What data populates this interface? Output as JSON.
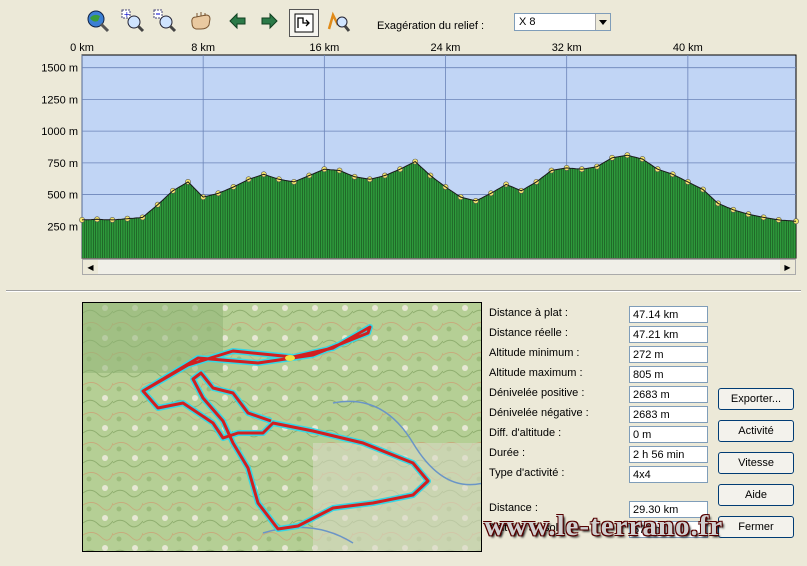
{
  "toolbar": {
    "icons": [
      "zoom-extent-icon",
      "zoom-in-icon",
      "zoom-out-icon",
      "hand-pan-icon",
      "arrow-left-icon",
      "arrow-right-icon",
      "profile-select-icon",
      "zoom-profile-icon"
    ],
    "relief_label": "Exagération du relief :",
    "relief_value": "X 8"
  },
  "chart_data": {
    "type": "area",
    "x_unit": "km",
    "y_unit": "m",
    "x_tick_labels": [
      "0 km",
      "8 km",
      "16 km",
      "24 km",
      "32 km",
      "40 km"
    ],
    "x_ticks": [
      0,
      8,
      16,
      24,
      32,
      40
    ],
    "y_tick_labels": [
      "1500 m",
      "1250 m",
      "1000 m",
      "750 m",
      "500 m",
      "250 m"
    ],
    "y_ticks": [
      1500,
      1250,
      1000,
      750,
      500,
      250
    ],
    "xlim": [
      0,
      47.14
    ],
    "ylim": [
      0,
      1600
    ],
    "grid": true,
    "colors": {
      "sky": "#c1d5f5",
      "fill": "#2e9a3c",
      "dark": "#0a1c0a",
      "point": "#f6e66b",
      "grid": "#6b84b8"
    },
    "x": [
      0,
      1,
      2,
      3,
      4,
      5,
      6,
      7,
      8,
      9,
      10,
      11,
      12,
      13,
      14,
      15,
      16,
      17,
      18,
      19,
      20,
      21,
      22,
      23,
      24,
      25,
      26,
      27,
      28,
      29,
      30,
      31,
      32,
      33,
      34,
      35,
      36,
      37,
      38,
      39,
      40,
      41,
      42,
      43,
      44,
      45,
      46,
      47.14
    ],
    "values": [
      300,
      305,
      300,
      310,
      320,
      420,
      530,
      600,
      480,
      510,
      560,
      620,
      660,
      620,
      600,
      650,
      700,
      690,
      640,
      620,
      650,
      700,
      760,
      650,
      560,
      480,
      450,
      510,
      580,
      530,
      600,
      690,
      710,
      700,
      720,
      790,
      810,
      780,
      700,
      660,
      600,
      540,
      430,
      380,
      345,
      320,
      300,
      290
    ]
  },
  "stats": [
    {
      "label": "Distance à plat :",
      "value": "47.14 km"
    },
    {
      "label": "Distance réelle :",
      "value": "47.21 km"
    },
    {
      "label": "Altitude minimum :",
      "value": "272 m"
    },
    {
      "label": "Altitude maximum :",
      "value": "805 m"
    },
    {
      "label": "Dénivelée positive :",
      "value": "2683 m"
    },
    {
      "label": "Dénivelée négative :",
      "value": "2683 m"
    },
    {
      "label": "Diff. d'altitude :",
      "value": "0 m"
    },
    {
      "label": "Durée :",
      "value": "2 h 56 min"
    },
    {
      "label": "Type d'activité :",
      "value": "4x4"
    }
  ],
  "cursor": [
    {
      "label": "Distance :",
      "value": "29.30 km"
    },
    {
      "label": "Altitude au sol :",
      "value": "576 m"
    }
  ],
  "buttons": {
    "export": "Exporter...",
    "activity": "Activité",
    "speed": "Vitesse",
    "help": "Aide",
    "close": "Fermer"
  },
  "watermark": "www.le-terrano.fr"
}
